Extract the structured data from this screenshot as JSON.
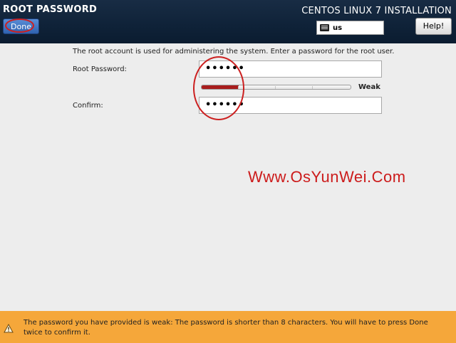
{
  "header": {
    "spoke_title": "ROOT PASSWORD",
    "done_label": "Done",
    "product_title": "CENTOS LINUX 7 INSTALLATION",
    "keyboard_layout": "us",
    "help_label": "Help!"
  },
  "main": {
    "intro_text": "The root account is used for administering the system.  Enter a password for the root user.",
    "root_password_label": "Root Password:",
    "root_password_value": "••••••",
    "strength": {
      "level": 0.25,
      "label": "Weak",
      "color": "#a81d1d"
    },
    "confirm_label": "Confirm:",
    "confirm_value": "••••••"
  },
  "watermark": "Www.OsYunWei.Com",
  "warning": {
    "text": "The password you have provided is weak: The password is shorter than 8 characters. You will have to press Done twice to confirm it.",
    "icon": "warning-icon",
    "color": "#f5a73a"
  }
}
